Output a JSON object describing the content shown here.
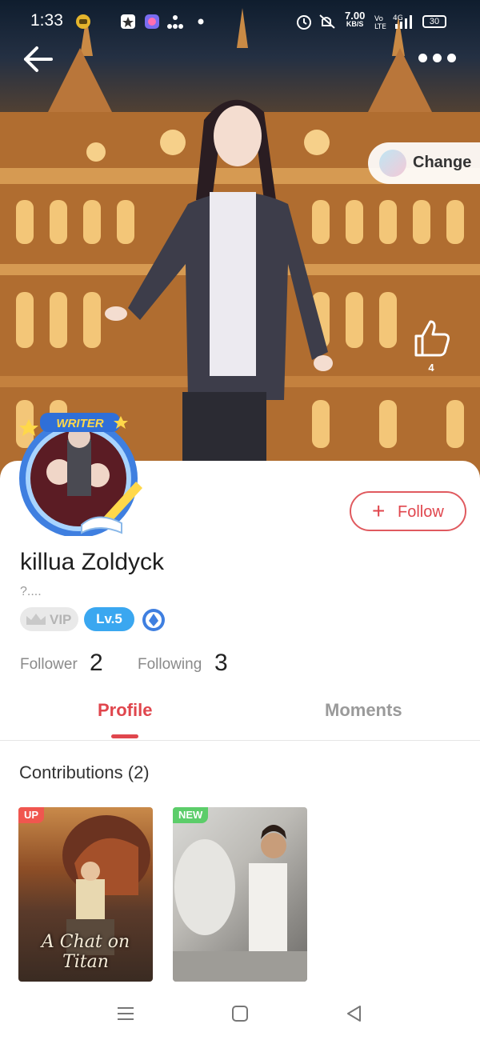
{
  "status_bar": {
    "time": "1:33",
    "speed_value": "7.00",
    "speed_unit": "KB/S",
    "battery": "30",
    "icons": [
      "app-notification-icon",
      "star-app-icon",
      "chat-app-icon",
      "network-icon",
      "dot-icon",
      "alarm-icon",
      "silent-icon",
      "volte-icon",
      "signal-4g-icon",
      "battery-icon"
    ]
  },
  "header": {
    "back_icon": "back-arrow-icon",
    "more_icon": "more-dots-icon",
    "change_label": "Change"
  },
  "likes": {
    "count": "4",
    "icon": "thumbs-up-icon"
  },
  "profile": {
    "badge_text": "WRITER",
    "name": "killua Zoldyck",
    "bio": "?....",
    "vip_label": "VIP",
    "level_label": "Lv.5",
    "follow_label": "Follow",
    "follower_label": "Follower",
    "follower_count": "2",
    "following_label": "Following",
    "following_count": "3"
  },
  "tabs": [
    {
      "label": "Profile",
      "active": true
    },
    {
      "label": "Moments",
      "active": false
    }
  ],
  "contributions": {
    "title": "Contributions (2)",
    "books": [
      {
        "tag": "UP",
        "cover_text": "A Chat on Titan"
      },
      {
        "tag": "NEW",
        "cover_text": ""
      }
    ]
  },
  "nav": [
    "menu-icon",
    "home-icon",
    "back-triangle-icon"
  ],
  "colors": {
    "accent": "#e0464d",
    "level": "#3aa7f0",
    "tag_up": "#f0564f",
    "tag_new": "#5ccd6a"
  }
}
